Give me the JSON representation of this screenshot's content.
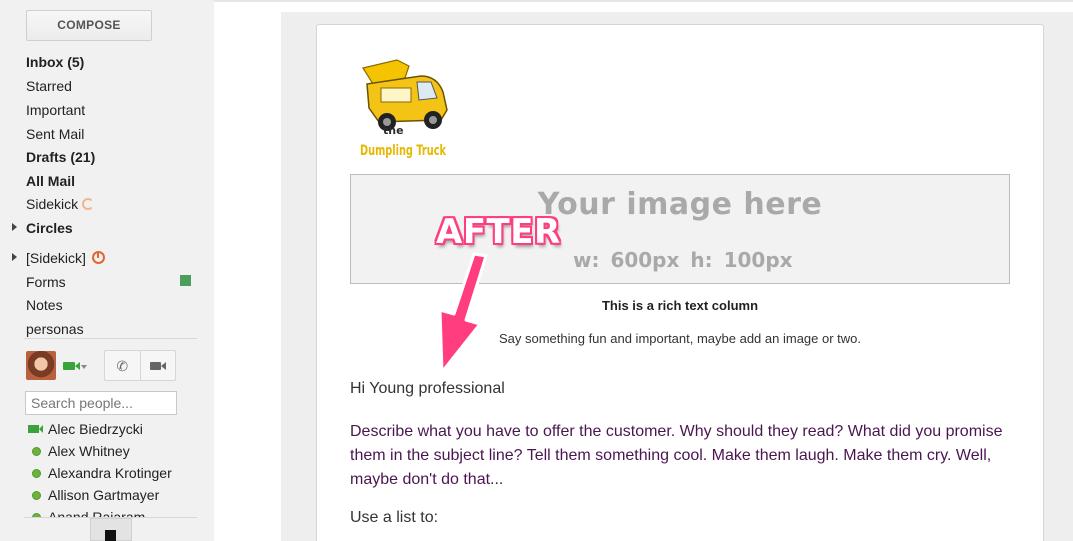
{
  "sidebar": {
    "compose_label": "COMPOSE",
    "items": [
      {
        "label": "Inbox (5)"
      },
      {
        "label": "Starred"
      },
      {
        "label": "Important"
      },
      {
        "label": "Sent Mail"
      },
      {
        "label": "Drafts (21)"
      },
      {
        "label": "All Mail"
      },
      {
        "label": "Sidekick"
      },
      {
        "label": "Circles"
      },
      {
        "label": "[Sidekick]"
      },
      {
        "label": "Forms"
      },
      {
        "label": "Notes"
      },
      {
        "label": "personas"
      }
    ],
    "label_colors": {
      "forms": "#4c9e5e",
      "sidekick_clock": "#e1662f"
    }
  },
  "chat": {
    "search_placeholder": "Search people...",
    "contacts": [
      {
        "name": "Alec Biedrzycki",
        "status": "video"
      },
      {
        "name": "Alex Whitney",
        "status": "online"
      },
      {
        "name": "Alexandra Krotinger",
        "status": "online"
      },
      {
        "name": "Allison Gartmayer",
        "status": "online"
      },
      {
        "name": "Anand Rajaram",
        "status": "online"
      }
    ]
  },
  "email": {
    "logo": {
      "line1": "the",
      "line2": "Dumpling Truck"
    },
    "image_placeholder": {
      "title": "Your image here",
      "dims": "w: 600px  h: 100px"
    },
    "rich_title": "This is a rich text column",
    "rich_subtitle": "Say something fun and important, maybe add an image or two.",
    "greeting": "Hi Young professional",
    "body": "Describe what you have to offer the customer. Why should they read? What did you promise them in the subject line? Tell them something cool. Make them laugh. Make them cry. Well, maybe don't do that...",
    "list_intro": "Use a list to:"
  },
  "annotation": {
    "label": "AFTER",
    "color": "#ff3d7f"
  }
}
